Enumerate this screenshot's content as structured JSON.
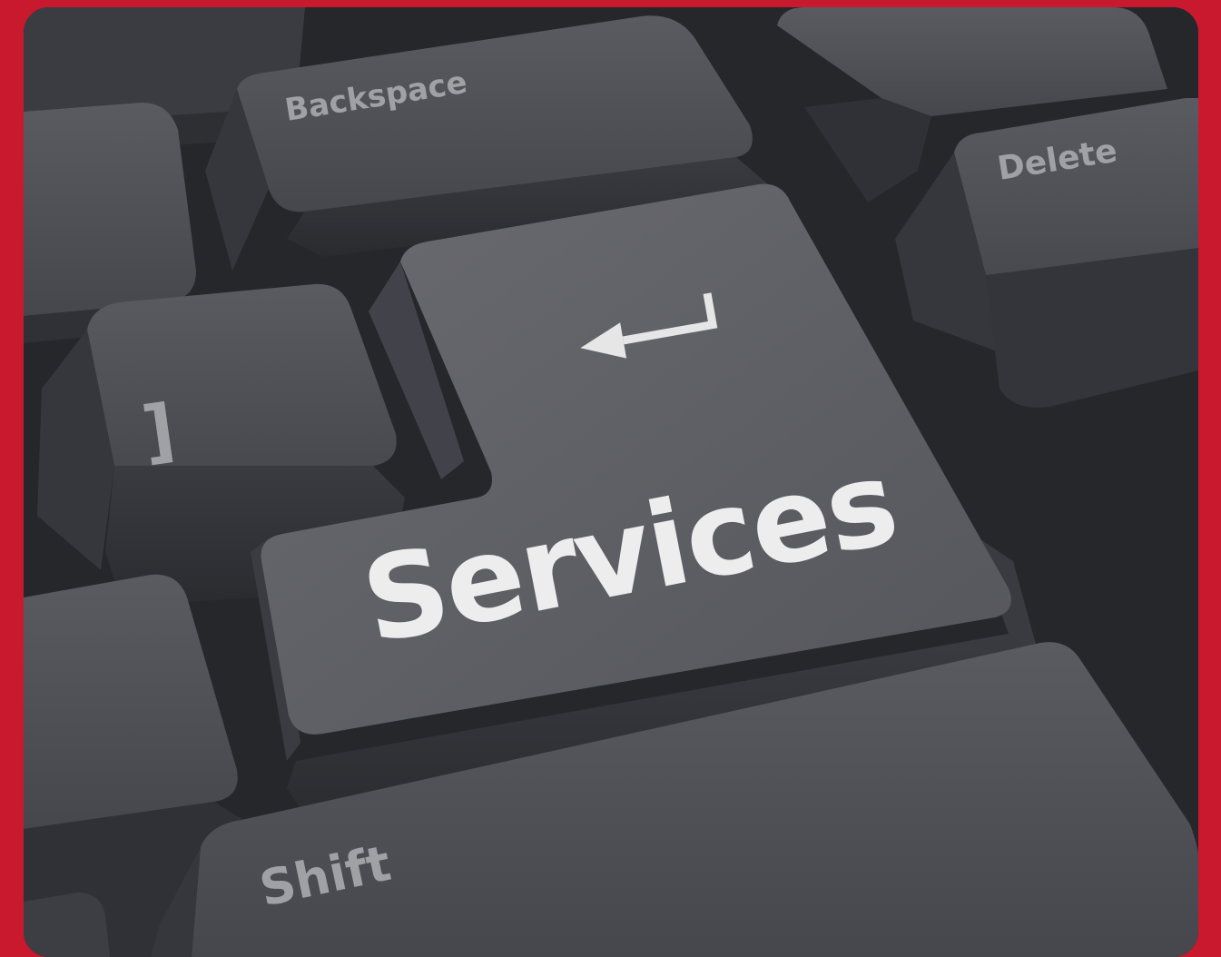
{
  "image": {
    "border_color": "#c8192e",
    "keycap_color": "#4a4b50",
    "legend_color_main": "#ededee",
    "legend_color_minor": "#9c9da1"
  },
  "keys": {
    "backspace": {
      "label": "Backspace"
    },
    "delete": {
      "label": "Delete"
    },
    "bracket": {
      "label": "]"
    },
    "enter": {
      "label": "Services",
      "icon": "return-arrow-icon"
    },
    "shift": {
      "label": "Shift"
    }
  }
}
